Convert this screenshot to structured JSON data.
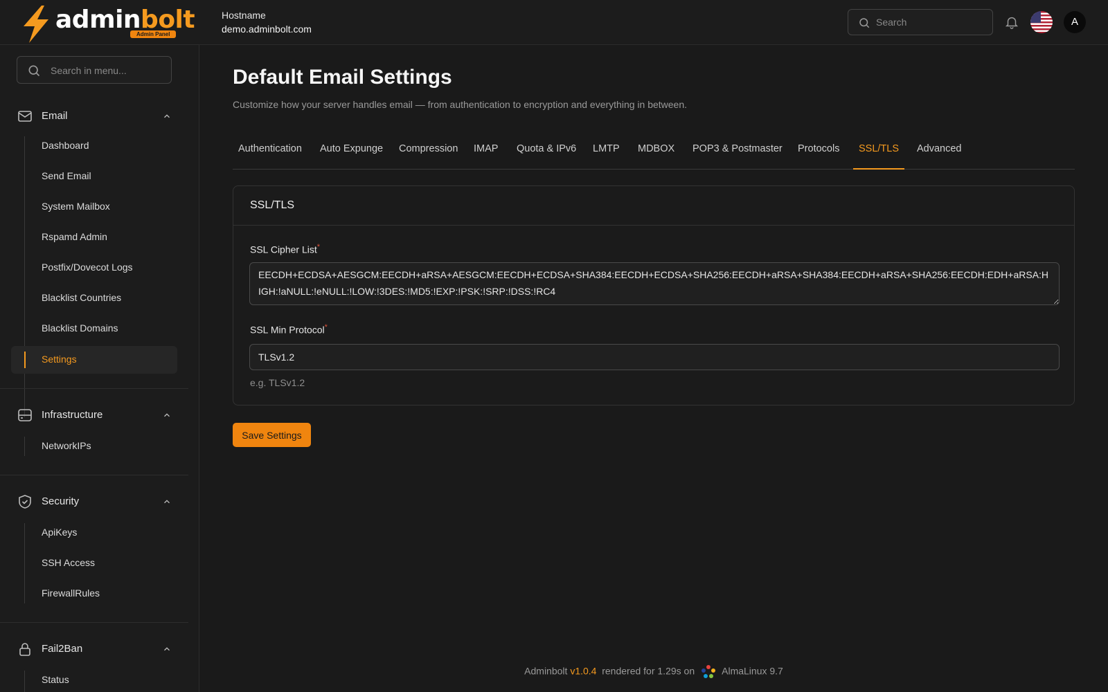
{
  "brand": {
    "name_part1": "admin",
    "name_part2": "bolt",
    "badge": "Admin Panel"
  },
  "header": {
    "hostname_label": "Hostname",
    "hostname_value": "demo.adminbolt.com",
    "search_placeholder": "Search",
    "avatar_initial": "A"
  },
  "sidebar": {
    "search_placeholder": "Search in menu...",
    "groups": [
      {
        "title": "Email",
        "icon": "mail-icon",
        "items": [
          "Dashboard",
          "Send Email",
          "System Mailbox",
          "Rspamd Admin",
          "Postfix/Dovecot Logs",
          "Blacklist Countries",
          "Blacklist Domains",
          "Settings"
        ],
        "active": "Settings"
      },
      {
        "title": "Infrastructure",
        "icon": "server-icon",
        "items": [
          "NetworkIPs"
        ]
      },
      {
        "title": "Security",
        "icon": "shield-icon",
        "items": [
          "ApiKeys",
          "SSH Access",
          "FirewallRules"
        ]
      },
      {
        "title": "Fail2Ban",
        "icon": "lock-icon",
        "items": [
          "Status"
        ]
      }
    ]
  },
  "main": {
    "title": "Default Email Settings",
    "subtitle": "Customize how your server handles email — from authentication to encryption and everything in between.",
    "tabs": [
      "Authentication",
      "Auto Expunge",
      "Compression",
      "IMAP",
      "Quota & IPv6",
      "LMTP",
      "MDBOX",
      "POP3 & Postmaster",
      "Protocols",
      "SSL/TLS",
      "Advanced"
    ],
    "active_tab": "SSL/TLS",
    "card": {
      "title": "SSL/TLS",
      "cipher_label": "SSL Cipher List",
      "cipher_value": "EECDH+ECDSA+AESGCM:EECDH+aRSA+AESGCM:EECDH+ECDSA+SHA384:EECDH+ECDSA+SHA256:EECDH+aRSA+SHA384:EECDH+aRSA+SHA256:EECDH:EDH+aRSA:HIGH:!aNULL:!eNULL:!LOW:!3DES:!MD5:!EXP:!PSK:!SRP:!DSS:!RC4",
      "protocol_label": "SSL Min Protocol",
      "protocol_value": "TLSv1.2",
      "protocol_hint": "e.g. TLSv1.2",
      "required_mark": "*"
    },
    "save_label": "Save Settings"
  },
  "footer": {
    "app": "Adminbolt",
    "version": "v1.0.4",
    "rendered": "rendered for 1.29s on",
    "os": "AlmaLinux 9.7"
  },
  "colors": {
    "accent": "#f59a1f",
    "button": "#f0850f",
    "background": "#1a1a1a",
    "required": "#e0533a"
  }
}
